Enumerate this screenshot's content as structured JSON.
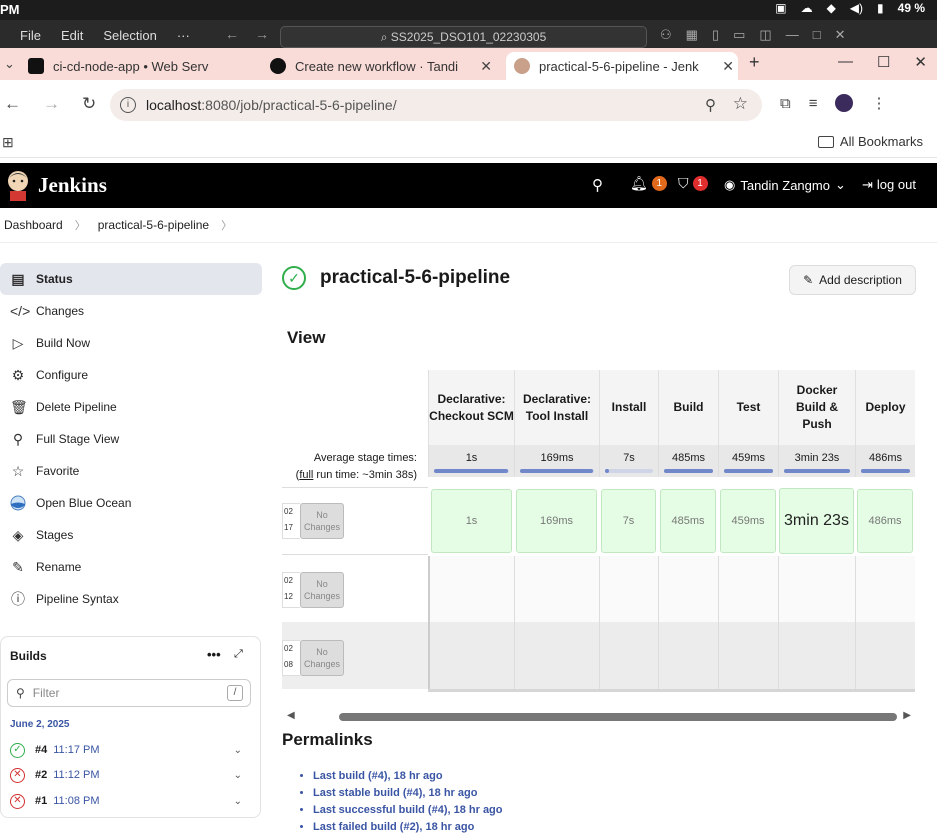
{
  "os": {
    "time": "PM",
    "battery": "49 %"
  },
  "menubar": {
    "menus": [
      "File",
      "Edit",
      "Selection",
      "···"
    ],
    "search": "SS2025_DSO101_02230305"
  },
  "tabs": [
    {
      "label": "ci-cd-node-app • Web Serv"
    },
    {
      "label": "Create new workflow · Tandi"
    },
    {
      "label": "practical-5-6-pipeline - Jenk"
    }
  ],
  "address": {
    "host": "localhost",
    "path": ":8080/job/practical-5-6-pipeline/"
  },
  "bookmarks": {
    "all": "All Bookmarks"
  },
  "header": {
    "brand": "Jenkins",
    "notifications": "1",
    "security": "1",
    "user": "Tandin Zangmo",
    "logout": "log out"
  },
  "breadcrumb": [
    "Dashboard",
    "practical-5-6-pipeline"
  ],
  "sidebar": {
    "items": [
      {
        "label": "Status",
        "icon": "document-icon"
      },
      {
        "label": "Changes",
        "icon": "code-icon"
      },
      {
        "label": "Build Now",
        "icon": "play-icon"
      },
      {
        "label": "Configure",
        "icon": "gear-icon"
      },
      {
        "label": "Delete Pipeline",
        "icon": "trash-icon"
      },
      {
        "label": "Full Stage View",
        "icon": "search-icon"
      },
      {
        "label": "Favorite",
        "icon": "star-icon"
      },
      {
        "label": "Open Blue Ocean",
        "icon": "blue-ocean-icon"
      },
      {
        "label": "Stages",
        "icon": "layers-icon"
      },
      {
        "label": "Rename",
        "icon": "pencil-icon"
      },
      {
        "label": "Pipeline Syntax",
        "icon": "help-icon"
      }
    ]
  },
  "builds": {
    "title": "Builds",
    "filter_placeholder": "Filter",
    "filter_shortcut": "/",
    "date": "June 2, 2025",
    "rows": [
      {
        "num": "#4",
        "time": "11:17 PM",
        "status": "success"
      },
      {
        "num": "#2",
        "time": "11:12 PM",
        "status": "failed"
      },
      {
        "num": "#1",
        "time": "11:08 PM",
        "status": "failed"
      }
    ]
  },
  "main": {
    "title": "practical-5-6-pipeline",
    "add_description": "Add description",
    "view_heading": "View",
    "permalinks_heading": "Permalinks"
  },
  "stage_view": {
    "avg_label_line1": "Average stage times:",
    "avg_label_full": "full",
    "avg_label_rest": " run time: ~3min 38s)",
    "avg_label_open": "(",
    "stages": [
      {
        "name": "Declarative: Checkout SCM",
        "avg": "1s",
        "fill": 0.99
      },
      {
        "name": "Declarative: Tool Install",
        "avg": "169ms",
        "fill": 0.99
      },
      {
        "name": "Install",
        "avg": "7s",
        "fill": 0.08
      },
      {
        "name": "Build",
        "avg": "485ms",
        "fill": 0.99
      },
      {
        "name": "Test",
        "avg": "459ms",
        "fill": 0.99
      },
      {
        "name": "Docker Build & Push",
        "avg": "3min 23s",
        "fill": 1.0
      },
      {
        "name": "Deploy",
        "avg": "486ms",
        "fill": 0.99
      }
    ],
    "runs": [
      {
        "stub_top": "02",
        "stub_bottom": "17",
        "no_changes": "No Changes",
        "cells": [
          "1s",
          "169ms",
          "7s",
          "485ms",
          "459ms",
          "3min 23s",
          "486ms"
        ]
      },
      {
        "stub_top": "02",
        "stub_bottom": "12",
        "no_changes": "No Changes",
        "cells": []
      },
      {
        "stub_top": "02",
        "stub_bottom": "08",
        "no_changes": "No Changes",
        "cells": []
      }
    ]
  },
  "permalinks": [
    "Last build (#4), 18 hr ago",
    "Last stable build (#4), 18 hr ago",
    "Last successful build (#4), 18 hr ago",
    "Last failed build (#2), 18 hr ago"
  ]
}
